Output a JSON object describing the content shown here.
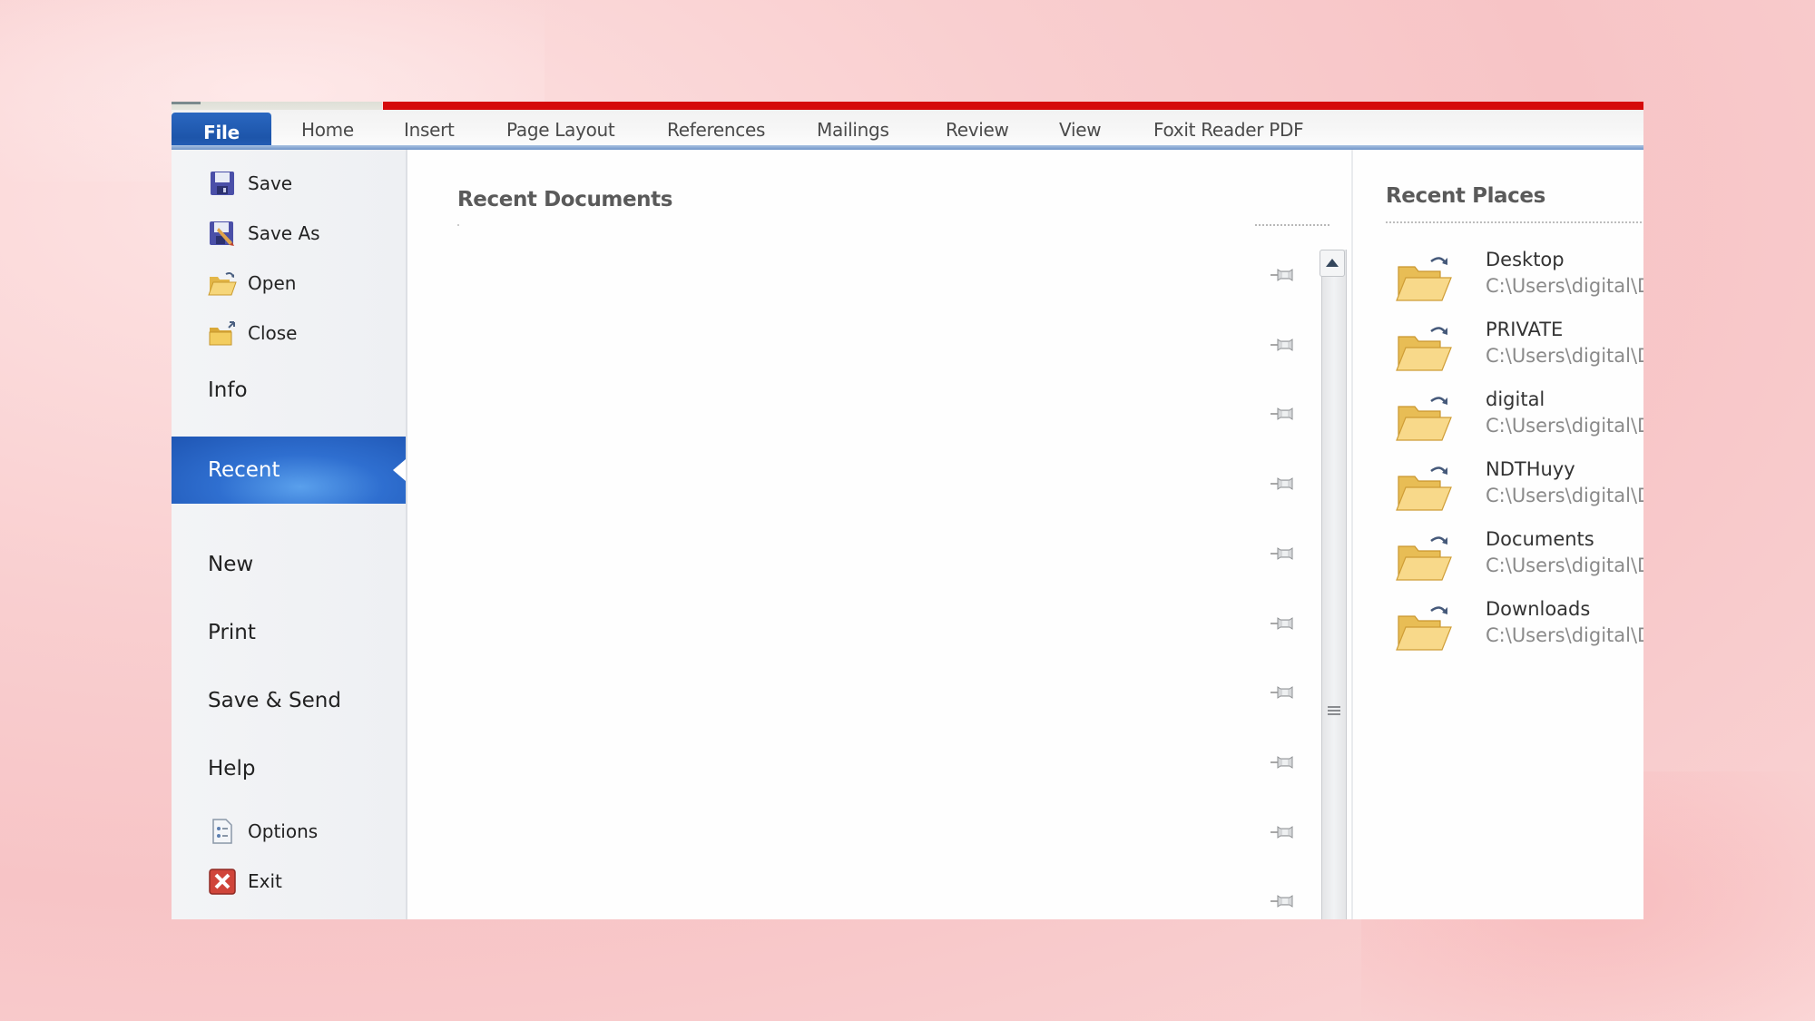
{
  "ribbon": {
    "tabs": [
      {
        "label": "File",
        "active": true
      },
      {
        "label": "Home"
      },
      {
        "label": "Insert"
      },
      {
        "label": "Page Layout"
      },
      {
        "label": "References"
      },
      {
        "label": "Mailings"
      },
      {
        "label": "Review"
      },
      {
        "label": "View"
      },
      {
        "label": "Foxit Reader PDF"
      }
    ],
    "accent_color": "#d50a0a",
    "file_tab_color": "#1d55aa"
  },
  "backstage_nav": {
    "commands": [
      {
        "label": "Save",
        "icon": "save-icon"
      },
      {
        "label": "Save As",
        "icon": "save-as-icon"
      },
      {
        "label": "Open",
        "icon": "open-folder-icon"
      },
      {
        "label": "Close",
        "icon": "close-folder-icon"
      }
    ],
    "sections": [
      {
        "label": "Info"
      },
      {
        "label": "Recent",
        "selected": true
      },
      {
        "label": "New"
      },
      {
        "label": "Print"
      },
      {
        "label": "Save & Send"
      },
      {
        "label": "Help"
      }
    ],
    "footer_commands": [
      {
        "label": "Options",
        "icon": "options-icon"
      },
      {
        "label": "Exit",
        "icon": "exit-icon"
      }
    ]
  },
  "recent_documents": {
    "title": "Recent Documents",
    "pinned_slots": 10
  },
  "recent_places": {
    "title": "Recent Places",
    "items": [
      {
        "name": "Desktop",
        "path": "C:\\Users\\digital\\D"
      },
      {
        "name": "PRIVATE",
        "path": "C:\\Users\\digital\\D"
      },
      {
        "name": "digital",
        "path": "C:\\Users\\digital\\D"
      },
      {
        "name": "NDTHuyy",
        "path": "C:\\Users\\digital\\D"
      },
      {
        "name": "Documents",
        "path": "C:\\Users\\digital\\D"
      },
      {
        "name": "Downloads",
        "path": "C:\\Users\\digital\\D"
      }
    ]
  }
}
